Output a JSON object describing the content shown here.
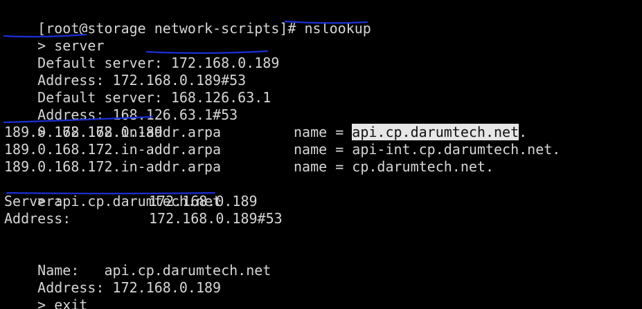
{
  "terminal": {
    "lines": [
      {
        "a": "[root@storage network-scripts]# nslookup"
      },
      {
        "a": "> server"
      },
      {
        "a": "Default server: 172.168.0.189"
      },
      {
        "a": "Address: 172.168.0.189#53"
      },
      {
        "a": "Default server: 168.126.63.1"
      },
      {
        "a": "Address: 168.126.63.1#53"
      },
      {
        "a": "> 172.168.0.189"
      },
      {
        "a": "189.0.168.172.in-addr.arpa",
        "b": "name = ",
        "c": "api.cp.darumtech.net",
        "d": "."
      },
      {
        "a": "189.0.168.172.in-addr.arpa",
        "b": "name = api-int.cp.darumtech.net."
      },
      {
        "a": "189.0.168.172.in-addr.arpa",
        "b": "name = cp.darumtech.net."
      },
      {
        "a": "> api.cp.darumtech.net"
      },
      {
        "a": "Server:",
        "b": "172.168.0.189"
      },
      {
        "a": "Address:",
        "b": "172.168.0.189#53"
      },
      {
        "a": ""
      },
      {
        "a": "Name:   api.cp.darumtech.net"
      },
      {
        "a": "Address: 172.168.0.189"
      },
      {
        "a": "> exit"
      }
    ]
  },
  "colors": {
    "background": "#000000",
    "text": "#d6d6d6",
    "selection": "#e6e6e6",
    "annotation_ink": "#1c2fd6"
  }
}
